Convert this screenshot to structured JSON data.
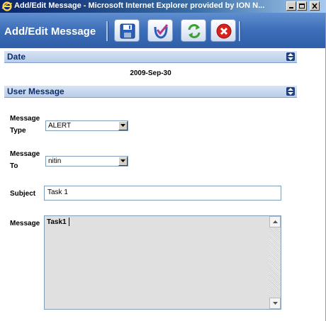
{
  "window": {
    "title": "Add/Edit Message - Microsoft Internet Explorer provided by ION N..."
  },
  "toolbar": {
    "heading": "Add/Edit Message",
    "buttons": [
      {
        "name": "save",
        "icon": "floppy-disk-icon"
      },
      {
        "name": "validate",
        "icon": "check-icon"
      },
      {
        "name": "refresh",
        "icon": "refresh-icon"
      },
      {
        "name": "close",
        "icon": "close-circle-icon"
      }
    ]
  },
  "sections": {
    "date": {
      "label": "Date",
      "value": "2009-Sep-30"
    },
    "user_message": {
      "label": "User Message"
    }
  },
  "form": {
    "message_type": {
      "label_line1": "Message",
      "label_line2": "Type",
      "value": "ALERT"
    },
    "message_to": {
      "label_line1": "Message",
      "label_line2": "To",
      "value": "nitin"
    },
    "subject": {
      "label": "Subject",
      "value": "Task 1"
    },
    "message": {
      "label": "Message",
      "value": "Task1"
    }
  },
  "colors": {
    "titlebar": "#0a246a",
    "toolbar": "#3c6db8",
    "section_bar": "#c6d7ee",
    "section_text": "#0b2f6a",
    "cancel_red": "#d9221c",
    "refresh_green": "#3da12f",
    "check_blue": "#2a5fb8"
  }
}
